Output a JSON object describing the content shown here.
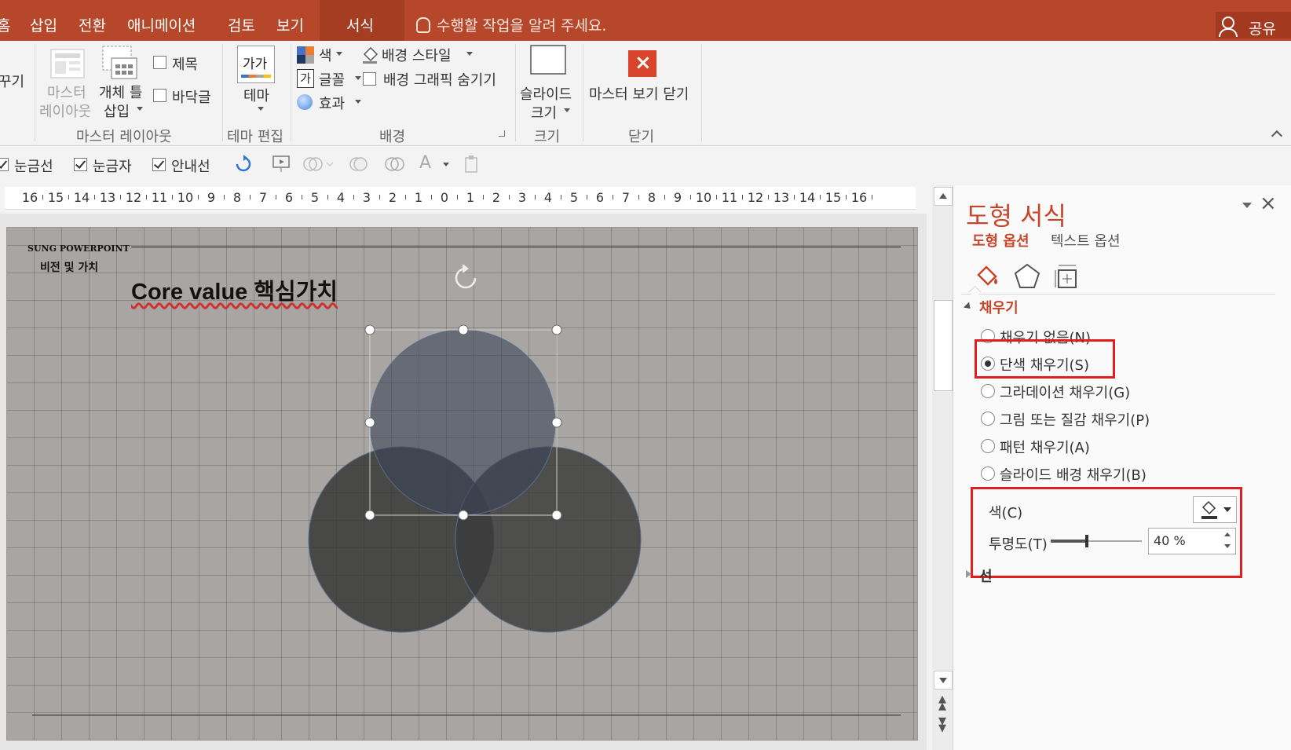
{
  "tabs": {
    "home_partial": "홈",
    "insert": "삽입",
    "transitions": "전환",
    "animations": "애니메이션",
    "review": "검토",
    "view": "보기",
    "format": "서식",
    "tell_me": "수행할 작업을 알려 주세요.",
    "share": "공유"
  },
  "ribbon": {
    "partial_left": "꾸기",
    "master_layout": {
      "btn_line1": "마스터",
      "btn_line2": "레이아웃",
      "insert_placeholder_line1": "개체 틀",
      "insert_placeholder_line2": "삽입",
      "title_check": "제목",
      "footer_check": "바닥글",
      "group": "마스터 레이아웃"
    },
    "theme": {
      "btn": "테마",
      "icon_text": "가가",
      "group": "테마 편집"
    },
    "background": {
      "colors": "색",
      "fonts": "글꼴",
      "effects": "효과",
      "bg_styles": "배경 스타일",
      "hide_bg": "배경 그래픽 숨기기",
      "group": "배경"
    },
    "size": {
      "btn_line1": "슬라이드",
      "btn_line2": "크기",
      "group": "크기"
    },
    "close": {
      "btn": "마스터 보기 닫기",
      "group": "닫기"
    }
  },
  "toolbar2": {
    "gridlines": "눈금선",
    "ruler": "눈금자",
    "guides": "안내선"
  },
  "ruler": {
    "ticks": [
      "16",
      "15",
      "14",
      "13",
      "12",
      "11",
      "10",
      "9",
      "8",
      "7",
      "6",
      "5",
      "4",
      "3",
      "2",
      "1",
      "0",
      "1",
      "2",
      "3",
      "4",
      "5",
      "6",
      "7",
      "8",
      "9",
      "10",
      "11",
      "12",
      "13",
      "14",
      "15",
      "16"
    ]
  },
  "slide": {
    "brand": "SUNG POWERPOINT",
    "section": "비전 및 가치",
    "title": "Core value 핵심가치"
  },
  "pane": {
    "title": "도형 서식",
    "tab_shape": "도형 옵션",
    "tab_text": "텍스트 옵션",
    "fill_section": "채우기",
    "fill_options": [
      "채우기 없음(N)",
      "단색 채우기(S)",
      "그라데이션 채우기(G)",
      "그림 또는 질감 채우기(P)",
      "패턴 채우기(A)",
      "슬라이드 배경 채우기(B)"
    ],
    "selected_fill": "단색 채우기(S)",
    "color_label": "색(C)",
    "transparency_label": "투명도(T)",
    "transparency_value": "40 %",
    "transparency_fraction": 0.4,
    "line_section": "선"
  },
  "colors": {
    "accent": "#b7472a",
    "pane_accent": "#c8452a",
    "highlight": "#e02020"
  }
}
